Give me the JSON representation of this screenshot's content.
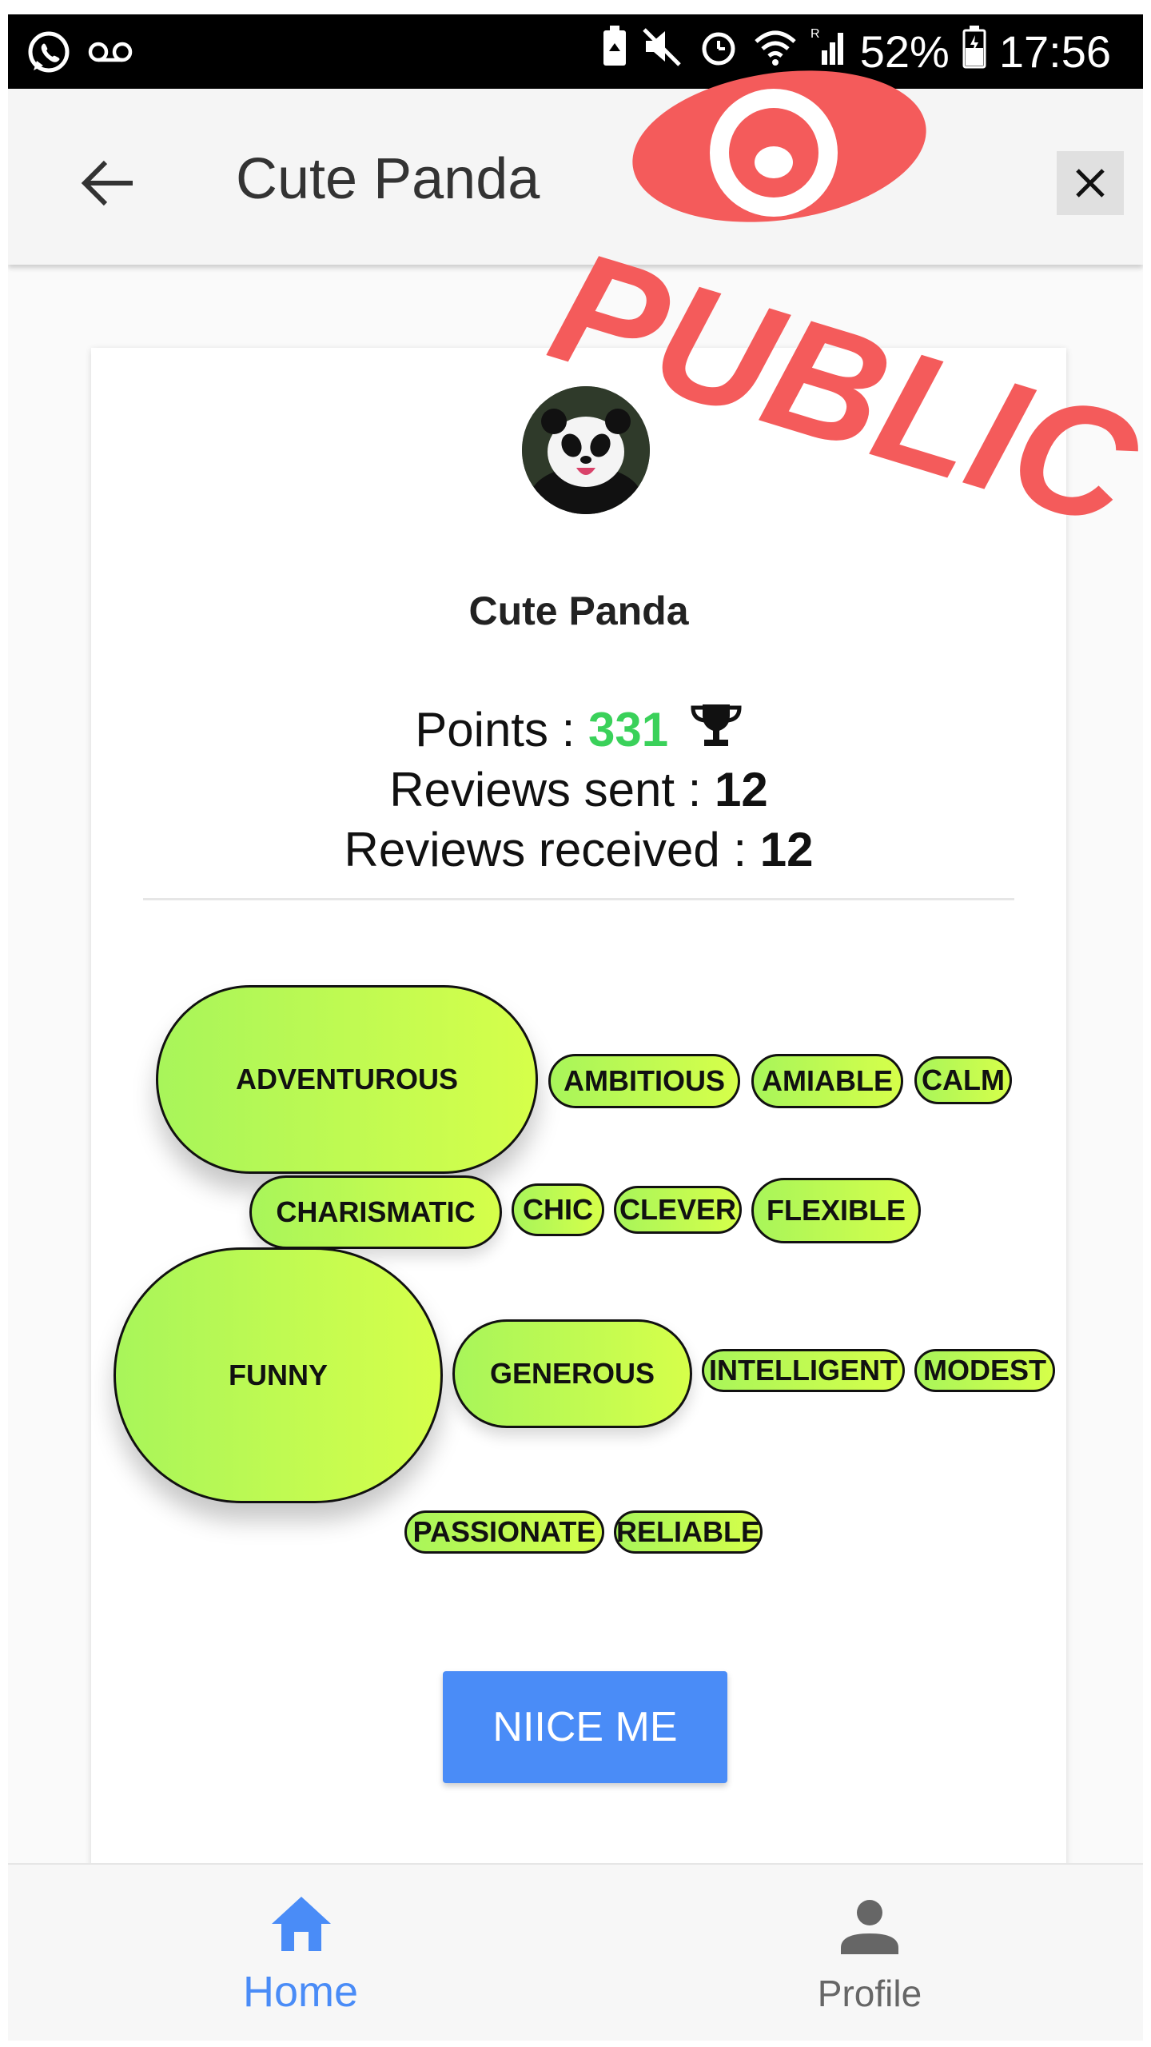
{
  "status_bar": {
    "battery_percent": "52%",
    "time": "17:56",
    "icons": [
      "whatsapp-icon",
      "voicemail-icon",
      "battery-saver-icon",
      "mute-icon",
      "alarm-icon",
      "wifi-icon",
      "signal-icon",
      "battery-icon"
    ]
  },
  "app_bar": {
    "title": "Cute Panda",
    "back_icon": "arrow-back-icon",
    "close_icon": "close-icon"
  },
  "stamp": {
    "text": "PUBLIC",
    "color": "#f45b5b",
    "icon": "eye-icon"
  },
  "profile": {
    "name": "Cute Panda",
    "avatar": "panda-avatar",
    "points_label": "Points : ",
    "points_value": "331",
    "reviews_sent_label": "Reviews sent : ",
    "reviews_sent_value": "12",
    "reviews_received_label": "Reviews received : ",
    "reviews_received_value": "12",
    "trophy_icon": "trophy-icon",
    "points_color": "#3ad15a"
  },
  "tags": [
    "ADVENTUROUS",
    "AMBITIOUS",
    "AMIABLE",
    "CALM",
    "CHARISMATIC",
    "CHIC",
    "CLEVER",
    "FLEXIBLE",
    "FUNNY",
    "GENEROUS",
    "INTELLIGENT",
    "MODEST",
    "PASSIONATE",
    "RELIABLE"
  ],
  "action_button": "NIICE ME",
  "bottom_nav": [
    {
      "label": "Home",
      "icon": "home-icon",
      "active": true,
      "color": "#4a8cf7"
    },
    {
      "label": "Profile",
      "icon": "person-icon",
      "active": false,
      "color": "#666666"
    }
  ]
}
